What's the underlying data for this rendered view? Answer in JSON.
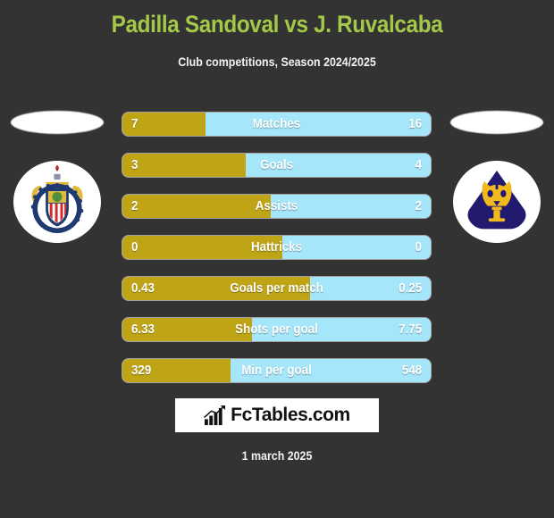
{
  "header": {
    "title": "Padilla Sandoval vs J. Ruvalcaba",
    "subtitle": "Club competitions, Season 2024/2025",
    "title_color": "#a4c848"
  },
  "teams": {
    "home": {
      "badge_icon": "chivas-guadalajara-crest-icon"
    },
    "away": {
      "badge_icon": "pumas-unam-crest-icon"
    }
  },
  "colors": {
    "background": "#333333",
    "home_bar": "#bfa515",
    "away_bar": "#a5e6fb",
    "text": "#ffffff"
  },
  "chart_data": {
    "type": "bar",
    "title": "Padilla Sandoval vs J. Ruvalcaba",
    "subtitle": "Club competitions, Season 2024/2025",
    "orientation": "horizontal-diverging",
    "categories": [
      "Matches",
      "Goals",
      "Assists",
      "Hattricks",
      "Goals per match",
      "Shots per goal",
      "Min per goal"
    ],
    "series": [
      {
        "name": "Padilla Sandoval",
        "values": [
          7,
          3,
          2,
          0,
          0.43,
          6.33,
          329
        ],
        "color": "#bfa515"
      },
      {
        "name": "J. Ruvalcaba",
        "values": [
          16,
          4,
          2,
          0,
          0.25,
          7.75,
          548
        ],
        "color": "#a5e6fb"
      }
    ],
    "legend": "none",
    "grid": false
  },
  "rows": [
    {
      "label": "Matches",
      "home": "7",
      "away": "16",
      "fill_pct": 27
    },
    {
      "label": "Goals",
      "home": "3",
      "away": "4",
      "fill_pct": 40
    },
    {
      "label": "Assists",
      "home": "2",
      "away": "2",
      "fill_pct": 48
    },
    {
      "label": "Hattricks",
      "home": "0",
      "away": "0",
      "fill_pct": 52
    },
    {
      "label": "Goals per match",
      "home": "0.43",
      "away": "0.25",
      "fill_pct": 61
    },
    {
      "label": "Shots per goal",
      "home": "6.33",
      "away": "7.75",
      "fill_pct": 42
    },
    {
      "label": "Min per goal",
      "home": "329",
      "away": "548",
      "fill_pct": 35
    }
  ],
  "footer": {
    "brand_text": "FcTables.com",
    "brand_icon": "bar-chart-growth-icon",
    "date": "1 march 2025"
  }
}
